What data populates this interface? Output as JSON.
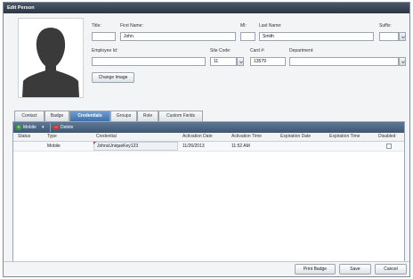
{
  "window": {
    "title": "Edit Person"
  },
  "form": {
    "title_label": "Title:",
    "title_value": "",
    "first_name_label": "First Name:",
    "first_name_value": "John",
    "mi_label": "MI:",
    "mi_value": "",
    "last_name_label": "Last Name:",
    "last_name_value": "Smith",
    "suffix_label": "Suffix:",
    "suffix_value": "",
    "employee_id_label": "Employee Id:",
    "employee_id_value": "",
    "site_code_label": "Site Code:",
    "site_code_value": "11",
    "card_label": "Card #:",
    "card_value": "13579",
    "department_label": "Department:",
    "department_value": "",
    "change_image_label": "Change Image"
  },
  "tabs": [
    {
      "label": "Contact"
    },
    {
      "label": "Badge"
    },
    {
      "label": "Credentials",
      "active": true
    },
    {
      "label": "Groups"
    },
    {
      "label": "Role"
    },
    {
      "label": "Custom Fields"
    }
  ],
  "toolbar": {
    "mobile_label": "Mobile",
    "delete_label": "Delete"
  },
  "grid": {
    "columns": [
      "Status",
      "Type",
      "Credential",
      "Activation Date",
      "Activation Time",
      "Expiration Date",
      "Expiration Time",
      "Disabled"
    ],
    "rows": [
      {
        "status": "",
        "type": "Mobile",
        "credential": "JohnsUniqueKey123",
        "activation_date": "11/26/2013",
        "activation_time": "11:52 AM",
        "expiration_date": "",
        "expiration_time": "",
        "disabled": false
      }
    ]
  },
  "footer": {
    "print_badge_label": "Print Badge",
    "save_label": "Save",
    "cancel_label": "Cancel"
  },
  "icons": {
    "add": "plus-circle-icon",
    "delete": "minus-circle-icon",
    "dropdown": "chevron-down-icon"
  },
  "colors": {
    "titlebar": "#2c3644",
    "active_tab": "#3f6fa8",
    "toolbar": "#3e5773",
    "add_icon": "#3aa536",
    "delete_icon": "#d9352b"
  }
}
